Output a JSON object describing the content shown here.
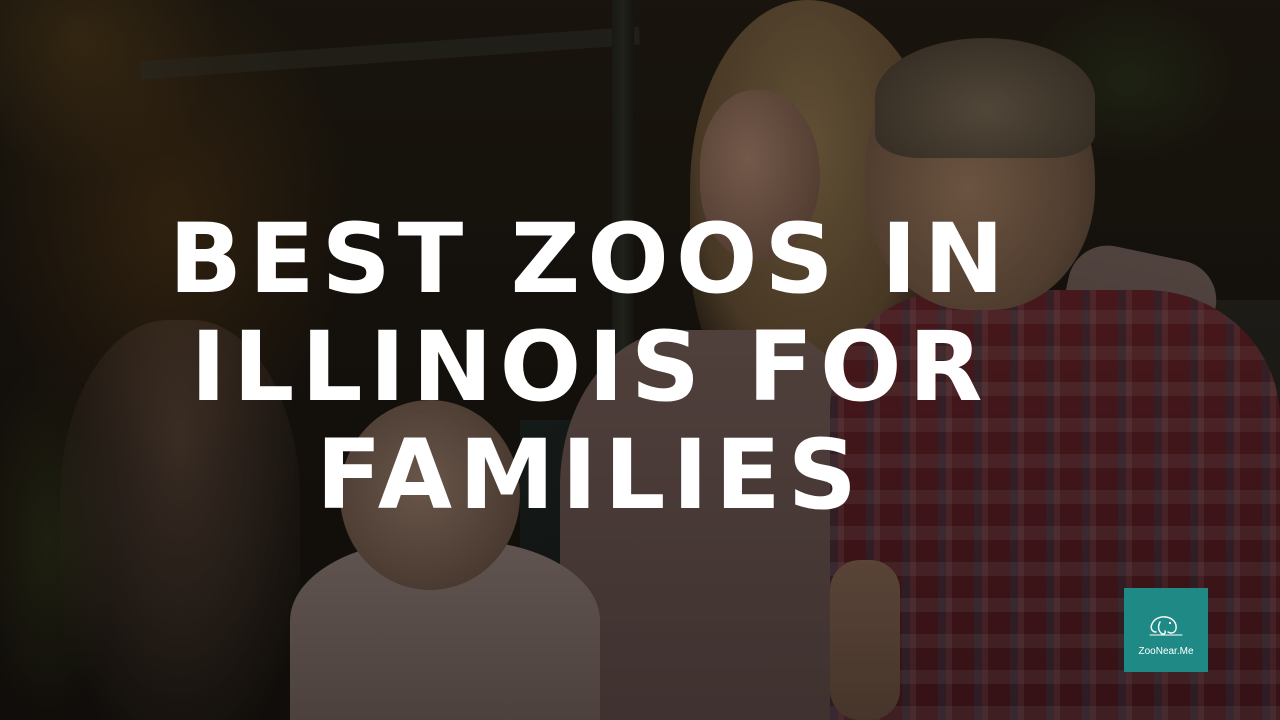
{
  "headline": {
    "line1": "BEST ZOOS IN",
    "line2": "ILLINOIS FOR",
    "line3": "FAMILIES"
  },
  "logo": {
    "text": "ZooNear.Me",
    "icon": "elephant-outline-icon",
    "background_color": "#1f8a85"
  },
  "overlay_color": "#000000"
}
